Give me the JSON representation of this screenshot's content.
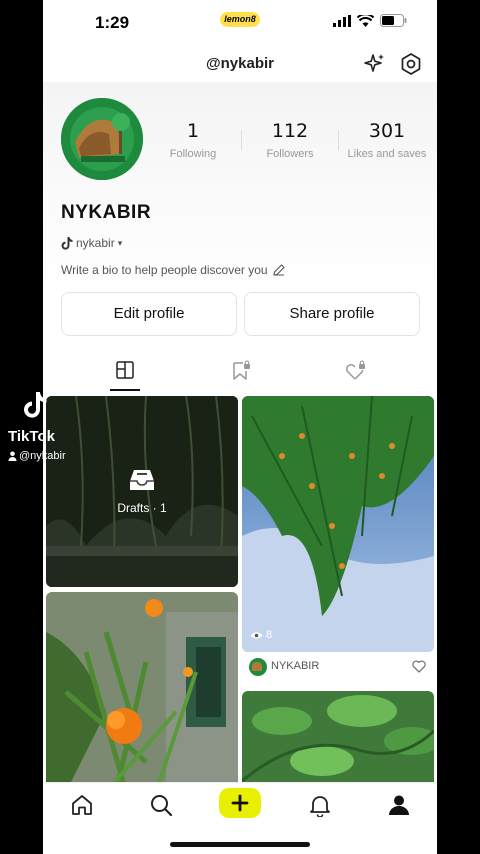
{
  "status_bar": {
    "time": "1:29",
    "badge": "lemon8"
  },
  "header": {
    "username": "@nykabir",
    "sparkle_icon": "sparkle-icon",
    "settings_icon": "gear-icon"
  },
  "profile": {
    "display_name": "NYKABIR",
    "tiktok_handle": "nykabir",
    "bio_placeholder": "Write a bio to help people discover you",
    "stats": [
      {
        "value": "1",
        "label": "Following"
      },
      {
        "value": "112",
        "label": "Followers"
      },
      {
        "value": "301",
        "label": "Likes and saves"
      }
    ]
  },
  "buttons": {
    "edit": "Edit profile",
    "share": "Share profile"
  },
  "tabs": [
    "grid-icon",
    "bookmark-lock-icon",
    "heart-lock-icon"
  ],
  "posts": {
    "drafts_label": "Drafts · 1",
    "post1_views": "8",
    "post1_author": "NYKABIR"
  },
  "watermark": {
    "brand": "TikTok",
    "handle": "@nykabir"
  },
  "bottom_nav": [
    "home-icon",
    "search-icon",
    "plus-icon",
    "bell-icon",
    "profile-icon"
  ],
  "colors": {
    "accent": "#e8f000",
    "avatar_green": "#1e8a3e"
  }
}
